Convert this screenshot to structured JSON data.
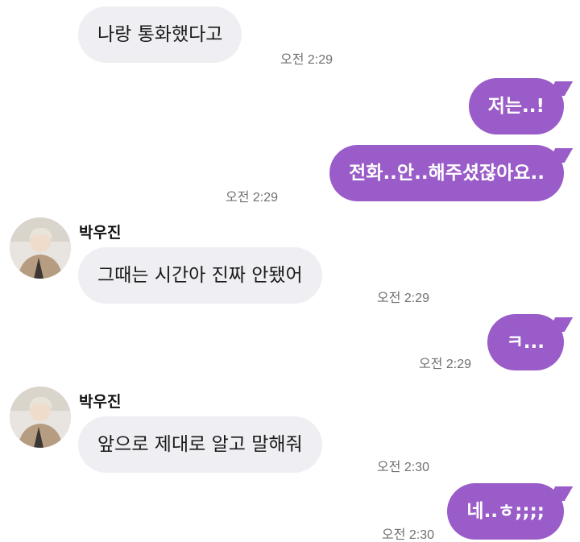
{
  "messages": [
    {
      "type": "in",
      "text": "나랑 통화했다고",
      "time": "오전 2:29"
    },
    {
      "type": "out",
      "text": "저는..!"
    },
    {
      "type": "out",
      "text": "전화..안..해주셨잖아요..",
      "time": "오전 2:29"
    },
    {
      "type": "in",
      "sender": "박우진",
      "text": "그때는 시간아 진짜 안됐어",
      "time": "오전 2:29"
    },
    {
      "type": "out",
      "text": "ㅋ...",
      "time": "오전 2:29"
    },
    {
      "type": "in",
      "sender": "박우진",
      "text": "앞으로 제대로 알고 말해줘",
      "time": "오전 2:30"
    },
    {
      "type": "out",
      "text": "네..ㅎ;;;;",
      "time": "오전 2:30"
    }
  ],
  "colors": {
    "outgoing_bubble": "#9a5cc8",
    "incoming_bubble": "#efeef2",
    "timestamp": "#707070"
  },
  "icons": {
    "avatar": "profile-photo"
  }
}
